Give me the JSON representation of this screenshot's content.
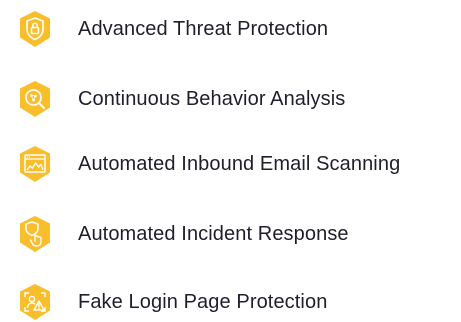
{
  "colors": {
    "accent": "#F9BE2C",
    "text": "#1F1F2B",
    "icon_line": "#FFFFFF"
  },
  "features": [
    {
      "icon": "shield-lock-icon",
      "label": "Advanced Threat Protection"
    },
    {
      "icon": "behavior-analysis-icon",
      "label": "Continuous Behavior Analysis"
    },
    {
      "icon": "email-scan-window-icon",
      "label": "Automated Inbound Email Scanning"
    },
    {
      "icon": "hand-shield-icon",
      "label": "Automated Incident Response"
    },
    {
      "icon": "fake-login-warning-icon",
      "label": "Fake Login Page Protection"
    }
  ]
}
